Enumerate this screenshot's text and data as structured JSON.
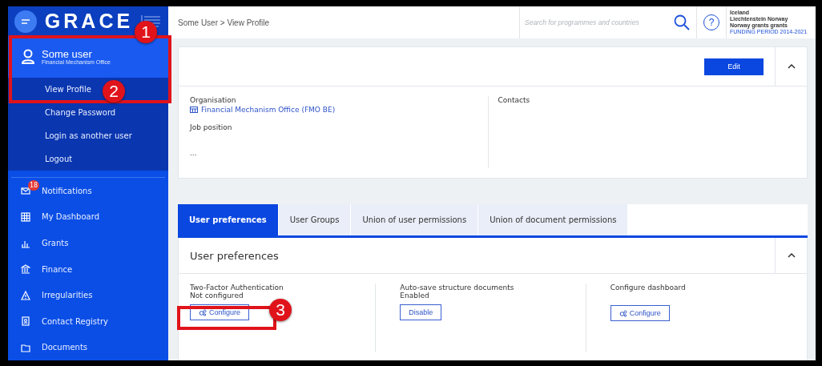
{
  "brand": {
    "name": "GRACE"
  },
  "user": {
    "name": "Some user",
    "organisation": "Financial Mechanism Office"
  },
  "user_menu": [
    {
      "label": "View Profile"
    },
    {
      "label": "Change Password"
    },
    {
      "label": "Login as another user"
    },
    {
      "label": "Logout"
    }
  ],
  "nav": [
    {
      "label": "Notifications",
      "badge": "18"
    },
    {
      "label": "My Dashboard"
    },
    {
      "label": "Grants"
    },
    {
      "label": "Finance"
    },
    {
      "label": "Irregularities"
    },
    {
      "label": "Contact Registry"
    },
    {
      "label": "Documents"
    }
  ],
  "breadcrumb": "Some User > View Profile",
  "search": {
    "placeholder": "Search for programmes and countries"
  },
  "help_button": "?",
  "funder_logo": {
    "lines": [
      "Iceland",
      "Liechtenstein Norway",
      "Norway grants grants"
    ],
    "period": "FUNDING PERIOD 2014-2021"
  },
  "profile": {
    "edit_button": "Edit",
    "organisation_label": "Organisation",
    "organisation": "Financial Mechanism Office (FMO BE)",
    "job_label": "Job position",
    "job_value": "...",
    "contacts_label": "Contacts"
  },
  "tabs": [
    {
      "label": "User preferences",
      "selected": true
    },
    {
      "label": "User Groups",
      "selected": false
    },
    {
      "label": "Union of user permissions",
      "selected": false
    },
    {
      "label": "Union of document permissions",
      "selected": false
    }
  ],
  "preferences": {
    "title": "User preferences",
    "items": [
      {
        "label": "Two-Factor Authentication",
        "status": "Not configured",
        "button": "Configure",
        "has_icon": true
      },
      {
        "label": "Auto-save structure documents",
        "status": "Enabled",
        "button": "Disable",
        "has_icon": false
      },
      {
        "label": "Configure dashboard",
        "button": "Configure",
        "has_icon": true
      }
    ]
  },
  "annotations": [
    {
      "label": "1"
    },
    {
      "label": "2"
    },
    {
      "label": "3"
    }
  ]
}
